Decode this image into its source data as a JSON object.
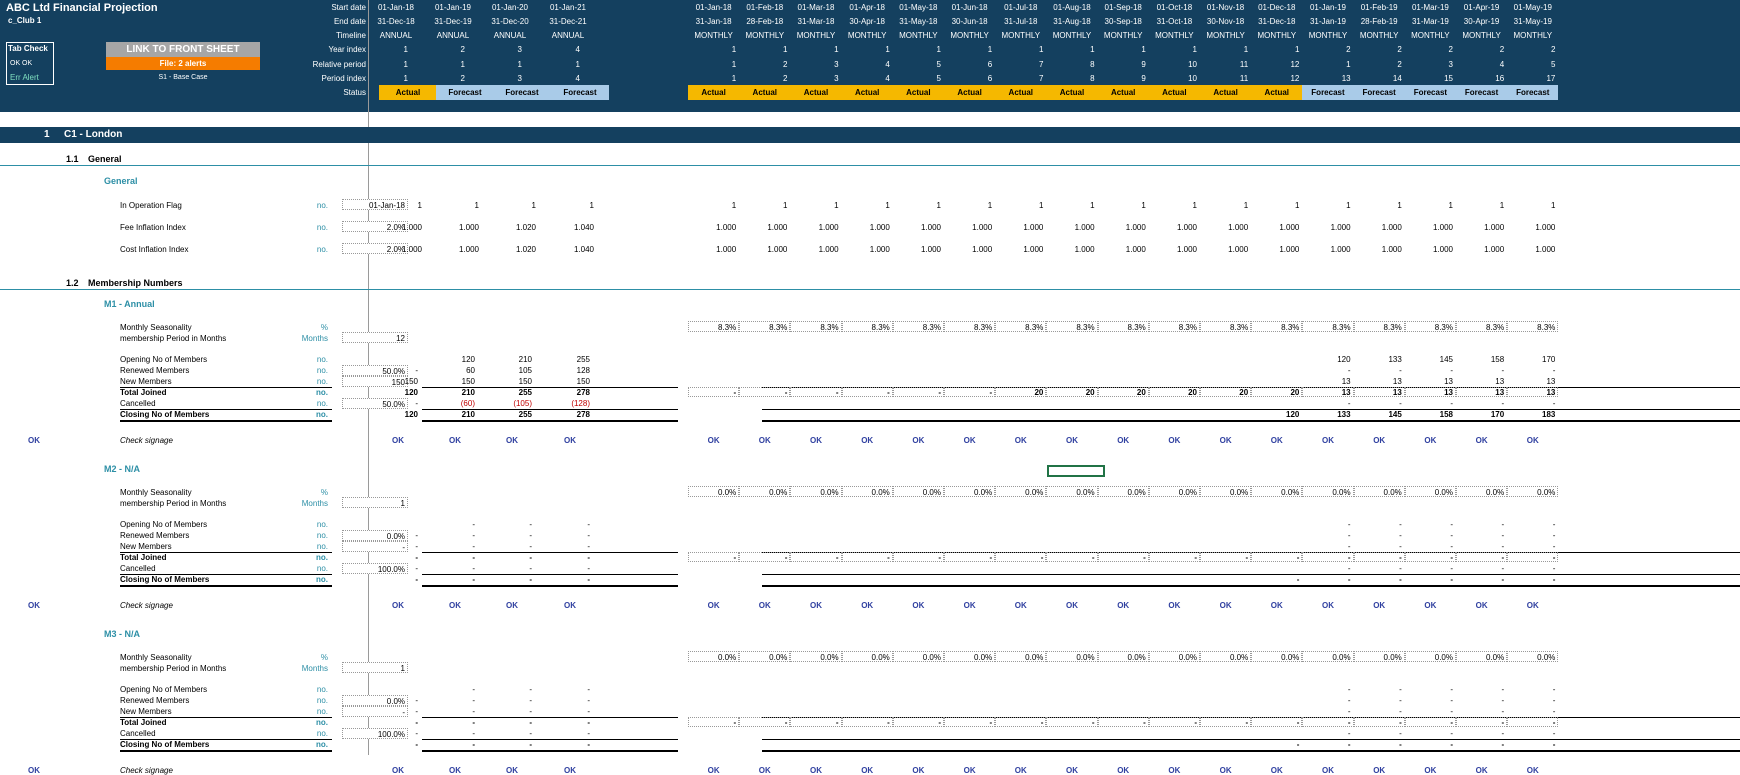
{
  "header": {
    "title": "ABC Ltd Financial Projection",
    "subtitle": "c_Club 1",
    "tab_check_label": "Tab Check",
    "tab_check_values": "OK   OK",
    "err_alert_label": "Err Alert",
    "link_button": "LINK TO FRONT SHEET",
    "file_alert": "File: 2 alerts",
    "scenario": "S1 - Base Case",
    "row_labels": [
      "Start date",
      "End date",
      "Timeline",
      "Year index",
      "Relative period",
      "Period index",
      "Status"
    ]
  },
  "annual_cols": [
    {
      "start": "01-Jan-18",
      "end": "31-Dec-18",
      "timeline": "ANNUAL",
      "year": "1",
      "rel": "1",
      "period": "1",
      "status": "Actual"
    },
    {
      "start": "01-Jan-19",
      "end": "31-Dec-19",
      "timeline": "ANNUAL",
      "year": "2",
      "rel": "1",
      "period": "2",
      "status": "Forecast"
    },
    {
      "start": "01-Jan-20",
      "end": "31-Dec-20",
      "timeline": "ANNUAL",
      "year": "3",
      "rel": "1",
      "period": "3",
      "status": "Forecast"
    },
    {
      "start": "01-Jan-21",
      "end": "31-Dec-21",
      "timeline": "ANNUAL",
      "year": "4",
      "rel": "1",
      "period": "4",
      "status": "Forecast"
    }
  ],
  "monthly_cols": [
    {
      "start": "01-Jan-18",
      "end": "31-Jan-18",
      "timeline": "MONTHLY",
      "year": "1",
      "rel": "1",
      "period": "1",
      "status": "Actual"
    },
    {
      "start": "01-Feb-18",
      "end": "28-Feb-18",
      "timeline": "MONTHLY",
      "year": "1",
      "rel": "2",
      "period": "2",
      "status": "Actual"
    },
    {
      "start": "01-Mar-18",
      "end": "31-Mar-18",
      "timeline": "MONTHLY",
      "year": "1",
      "rel": "3",
      "period": "3",
      "status": "Actual"
    },
    {
      "start": "01-Apr-18",
      "end": "30-Apr-18",
      "timeline": "MONTHLY",
      "year": "1",
      "rel": "4",
      "period": "4",
      "status": "Actual"
    },
    {
      "start": "01-May-18",
      "end": "31-May-18",
      "timeline": "MONTHLY",
      "year": "1",
      "rel": "5",
      "period": "5",
      "status": "Actual"
    },
    {
      "start": "01-Jun-18",
      "end": "30-Jun-18",
      "timeline": "MONTHLY",
      "year": "1",
      "rel": "6",
      "period": "6",
      "status": "Actual"
    },
    {
      "start": "01-Jul-18",
      "end": "31-Jul-18",
      "timeline": "MONTHLY",
      "year": "1",
      "rel": "7",
      "period": "7",
      "status": "Actual"
    },
    {
      "start": "01-Aug-18",
      "end": "31-Aug-18",
      "timeline": "MONTHLY",
      "year": "1",
      "rel": "8",
      "period": "8",
      "status": "Actual"
    },
    {
      "start": "01-Sep-18",
      "end": "30-Sep-18",
      "timeline": "MONTHLY",
      "year": "1",
      "rel": "9",
      "period": "9",
      "status": "Actual"
    },
    {
      "start": "01-Oct-18",
      "end": "31-Oct-18",
      "timeline": "MONTHLY",
      "year": "1",
      "rel": "10",
      "period": "10",
      "status": "Actual"
    },
    {
      "start": "01-Nov-18",
      "end": "30-Nov-18",
      "timeline": "MONTHLY",
      "year": "1",
      "rel": "11",
      "period": "11",
      "status": "Actual"
    },
    {
      "start": "01-Dec-18",
      "end": "31-Dec-18",
      "timeline": "MONTHLY",
      "year": "1",
      "rel": "12",
      "period": "12",
      "status": "Actual"
    },
    {
      "start": "01-Jan-19",
      "end": "31-Jan-19",
      "timeline": "MONTHLY",
      "year": "2",
      "rel": "1",
      "period": "13",
      "status": "Forecast"
    },
    {
      "start": "01-Feb-19",
      "end": "28-Feb-19",
      "timeline": "MONTHLY",
      "year": "2",
      "rel": "2",
      "period": "14",
      "status": "Forecast"
    },
    {
      "start": "01-Mar-19",
      "end": "31-Mar-19",
      "timeline": "MONTHLY",
      "year": "2",
      "rel": "3",
      "period": "15",
      "status": "Forecast"
    },
    {
      "start": "01-Apr-19",
      "end": "30-Apr-19",
      "timeline": "MONTHLY",
      "year": "2",
      "rel": "4",
      "period": "16",
      "status": "Forecast"
    },
    {
      "start": "01-May-19",
      "end": "31-May-19",
      "timeline": "MONTHLY",
      "year": "2",
      "rel": "5",
      "period": "17",
      "status": "Forecast"
    }
  ],
  "section1": {
    "num": "1",
    "title": "C1 - London"
  },
  "s11": {
    "num": "1.1",
    "title": "General",
    "group": "General"
  },
  "general_rows": [
    {
      "label": "In Operation Flag",
      "unit": "no.",
      "input": "01-Jan-18",
      "annual": [
        "1",
        "1",
        "1",
        "1"
      ],
      "monthly": [
        "1",
        "1",
        "1",
        "1",
        "1",
        "1",
        "1",
        "1",
        "1",
        "1",
        "1",
        "1",
        "1",
        "1",
        "1",
        "1",
        "1"
      ]
    },
    {
      "label": "Fee Inflation Index",
      "unit": "no.",
      "input": "2.0%",
      "annual": [
        "1.000",
        "1.000",
        "1.020",
        "1.040"
      ],
      "monthly": [
        "1.000",
        "1.000",
        "1.000",
        "1.000",
        "1.000",
        "1.000",
        "1.000",
        "1.000",
        "1.000",
        "1.000",
        "1.000",
        "1.000",
        "1.000",
        "1.000",
        "1.000",
        "1.000",
        "1.000"
      ]
    },
    {
      "label": "Cost Inflation Index",
      "unit": "no.",
      "input": "2.0%",
      "annual": [
        "1.000",
        "1.000",
        "1.020",
        "1.040"
      ],
      "monthly": [
        "1.000",
        "1.000",
        "1.000",
        "1.000",
        "1.000",
        "1.000",
        "1.000",
        "1.000",
        "1.000",
        "1.000",
        "1.000",
        "1.000",
        "1.000",
        "1.000",
        "1.000",
        "1.000",
        "1.000"
      ]
    }
  ],
  "s12": {
    "num": "1.2",
    "title": "Membership Numbers"
  },
  "blocks": [
    {
      "title": "M1 - Annual",
      "seasonality": {
        "label": "Monthly Seasonality",
        "unit": "%",
        "monthly": [
          "8.3%",
          "8.3%",
          "8.3%",
          "8.3%",
          "8.3%",
          "8.3%",
          "8.3%",
          "8.3%",
          "8.3%",
          "8.3%",
          "8.3%",
          "8.3%",
          "8.3%",
          "8.3%",
          "8.3%",
          "8.3%",
          "8.3%"
        ]
      },
      "period": {
        "label": "membership Period in Months",
        "unit": "Months",
        "input": "12"
      },
      "opening": {
        "label": "Opening No of Members",
        "unit": "no.",
        "annual": [
          "",
          "120",
          "210",
          "255"
        ],
        "monthly": [
          "",
          "",
          "",
          "",
          "",
          "",
          "",
          "",
          "",
          "",
          "",
          "",
          "120",
          "133",
          "145",
          "158",
          "170"
        ]
      },
      "renewed": {
        "label": "Renewed Members",
        "unit": "no.",
        "input": "50.0%",
        "annual": [
          "-",
          "60",
          "105",
          "128"
        ],
        "monthly": [
          "",
          "",
          "",
          "",
          "",
          "",
          "",
          "",
          "",
          "",
          "",
          "",
          "-",
          "-",
          "-",
          "-",
          "-"
        ]
      },
      "new": {
        "label": "New Members",
        "unit": "no.",
        "input": "150",
        "annual": [
          "150",
          "150",
          "150",
          "150"
        ],
        "monthly": [
          "",
          "",
          "",
          "",
          "",
          "",
          "",
          "",
          "",
          "",
          "",
          "",
          "13",
          "13",
          "13",
          "13",
          "13"
        ]
      },
      "total": {
        "label": "Total Joined",
        "unit": "no.",
        "annual": [
          "120",
          "210",
          "255",
          "278"
        ],
        "monthly": [
          "-",
          "-",
          "-",
          "-",
          "-",
          "-",
          "20",
          "20",
          "20",
          "20",
          "20",
          "20",
          "13",
          "13",
          "13",
          "13",
          "13"
        ]
      },
      "cancelled": {
        "label": "Cancelled",
        "unit": "no.",
        "input": "50.0%",
        "annual": [
          "-",
          "(60)",
          "(105)",
          "(128)"
        ],
        "monthly": [
          "",
          "",
          "",
          "",
          "",
          "",
          "",
          "",
          "",
          "",
          "",
          "",
          "-",
          "-",
          "-",
          "-",
          "-"
        ]
      },
      "closing": {
        "label": "Closing No of Members",
        "unit": "no.",
        "annual": [
          "120",
          "210",
          "255",
          "278"
        ],
        "monthly": [
          "",
          "",
          "",
          "",
          "",
          "",
          "",
          "",
          "",
          "",
          "",
          "120",
          "133",
          "145",
          "158",
          "170",
          "183"
        ]
      },
      "check": {
        "label": "Check signage",
        "ok": "OK"
      }
    },
    {
      "title": "M2 - N/A",
      "seasonality": {
        "label": "Monthly Seasonality",
        "unit": "%",
        "monthly": [
          "0.0%",
          "0.0%",
          "0.0%",
          "0.0%",
          "0.0%",
          "0.0%",
          "0.0%",
          "0.0%",
          "0.0%",
          "0.0%",
          "0.0%",
          "0.0%",
          "0.0%",
          "0.0%",
          "0.0%",
          "0.0%",
          "0.0%"
        ]
      },
      "period": {
        "label": "membership Period in Months",
        "unit": "Months",
        "input": "1"
      },
      "opening": {
        "label": "Opening No of Members",
        "unit": "no.",
        "annual": [
          "",
          "-",
          "-",
          "-"
        ],
        "monthly": [
          "",
          "",
          "",
          "",
          "",
          "",
          "",
          "",
          "",
          "",
          "",
          "",
          "-",
          "-",
          "-",
          "-",
          "-"
        ]
      },
      "renewed": {
        "label": "Renewed Members",
        "unit": "no.",
        "input": "0.0%",
        "annual": [
          "-",
          "-",
          "-",
          "-"
        ],
        "monthly": [
          "",
          "",
          "",
          "",
          "",
          "",
          "",
          "",
          "",
          "",
          "",
          "",
          "-",
          "-",
          "-",
          "-",
          "-"
        ]
      },
      "new": {
        "label": "New Members",
        "unit": "no.",
        "input": "-",
        "annual": [
          "-",
          "-",
          "-",
          "-"
        ],
        "monthly": [
          "",
          "",
          "",
          "",
          "",
          "",
          "",
          "",
          "",
          "",
          "",
          "",
          "-",
          "-",
          "-",
          "-",
          "-"
        ]
      },
      "total": {
        "label": "Total Joined",
        "unit": "no.",
        "annual": [
          "-",
          "-",
          "-",
          "-"
        ],
        "monthly": [
          "-",
          "-",
          "-",
          "-",
          "-",
          "-",
          "-",
          "-",
          "-",
          "-",
          "-",
          "-",
          "-",
          "-",
          "-",
          "-",
          "-"
        ]
      },
      "cancelled": {
        "label": "Cancelled",
        "unit": "no.",
        "input": "100.0%",
        "annual": [
          "-",
          "-",
          "-",
          "-"
        ],
        "monthly": [
          "",
          "",
          "",
          "",
          "",
          "",
          "",
          "",
          "",
          "",
          "",
          "",
          "-",
          "-",
          "-",
          "-",
          "-"
        ]
      },
      "closing": {
        "label": "Closing No of Members",
        "unit": "no.",
        "annual": [
          "-",
          "-",
          "-",
          "-"
        ],
        "monthly": [
          "",
          "",
          "",
          "",
          "",
          "",
          "",
          "",
          "",
          "",
          "",
          "-",
          "-",
          "-",
          "-",
          "-",
          "-"
        ]
      },
      "check": {
        "label": "Check signage",
        "ok": "OK"
      }
    },
    {
      "title": "M3 - N/A",
      "seasonality": {
        "label": "Monthly Seasonality",
        "unit": "%",
        "monthly": [
          "0.0%",
          "0.0%",
          "0.0%",
          "0.0%",
          "0.0%",
          "0.0%",
          "0.0%",
          "0.0%",
          "0.0%",
          "0.0%",
          "0.0%",
          "0.0%",
          "0.0%",
          "0.0%",
          "0.0%",
          "0.0%",
          "0.0%"
        ]
      },
      "period": {
        "label": "membership Period in Months",
        "unit": "Months",
        "input": "1"
      },
      "opening": {
        "label": "Opening No of Members",
        "unit": "no.",
        "annual": [
          "",
          "-",
          "-",
          "-"
        ],
        "monthly": [
          "",
          "",
          "",
          "",
          "",
          "",
          "",
          "",
          "",
          "",
          "",
          "",
          "-",
          "-",
          "-",
          "-",
          "-"
        ]
      },
      "renewed": {
        "label": "Renewed Members",
        "unit": "no.",
        "input": "0.0%",
        "annual": [
          "-",
          "-",
          "-",
          "-"
        ],
        "monthly": [
          "",
          "",
          "",
          "",
          "",
          "",
          "",
          "",
          "",
          "",
          "",
          "",
          "-",
          "-",
          "-",
          "-",
          "-"
        ]
      },
      "new": {
        "label": "New Members",
        "unit": "no.",
        "input": "-",
        "annual": [
          "-",
          "-",
          "-",
          "-"
        ],
        "monthly": [
          "",
          "",
          "",
          "",
          "",
          "",
          "",
          "",
          "",
          "",
          "",
          "",
          "-",
          "-",
          "-",
          "-",
          "-"
        ]
      },
      "total": {
        "label": "Total Joined",
        "unit": "no.",
        "annual": [
          "-",
          "-",
          "-",
          "-"
        ],
        "monthly": [
          "-",
          "-",
          "-",
          "-",
          "-",
          "-",
          "-",
          "-",
          "-",
          "-",
          "-",
          "-",
          "-",
          "-",
          "-",
          "-",
          "-"
        ]
      },
      "cancelled": {
        "label": "Cancelled",
        "unit": "no.",
        "input": "100.0%",
        "annual": [
          "-",
          "-",
          "-",
          "-"
        ],
        "monthly": [
          "",
          "",
          "",
          "",
          "",
          "",
          "",
          "",
          "",
          "",
          "",
          "",
          "-",
          "-",
          "-",
          "-",
          "-"
        ]
      },
      "closing": {
        "label": "Closing No of Members",
        "unit": "no.",
        "annual": [
          "-",
          "-",
          "-",
          "-"
        ],
        "monthly": [
          "",
          "",
          "",
          "",
          "",
          "",
          "",
          "",
          "",
          "",
          "",
          "-",
          "-",
          "-",
          "-",
          "-",
          "-"
        ]
      },
      "check": {
        "label": "Check signage",
        "ok": "OK"
      }
    }
  ],
  "colors": {
    "header_bg": "#14405f",
    "actual": "#f5b800",
    "forecast": "#a9cbe8",
    "orange_button": "#f57c00",
    "teal": "#2d8fa6"
  }
}
